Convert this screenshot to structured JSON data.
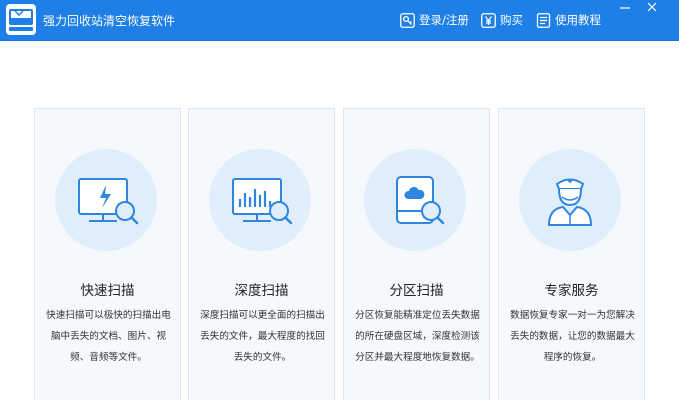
{
  "window": {
    "title": "强力回收站清空恢复软件"
  },
  "toolbar": {
    "login_label": "登录/注册",
    "buy_label": "购买",
    "tutorial_label": "使用教程"
  },
  "cards": [
    {
      "title": "快速扫描",
      "desc": "快速扫描可以极快的扫描出电脑中丢失的文档、图片、视频、音频等文件。",
      "icon": "monitor-lightning-search-icon"
    },
    {
      "title": "深度扫描",
      "desc": "深度扫描可以更全面的扫描出丢失的文件，最大程度的找回丢失的文件。",
      "icon": "monitor-chart-search-icon"
    },
    {
      "title": "分区扫描",
      "desc": "分区恢复能精准定位丢失数据的所在硬盘区域，深度检测该分区并最大程度地恢复数据。",
      "icon": "disk-cloud-search-icon"
    },
    {
      "title": "专家服务",
      "desc": "数据恢复专家一对一为您解决丢失的数据，让您的数据最大程序的恢复。",
      "icon": "doctor-icon"
    }
  ],
  "colors": {
    "titlebar": "#1e7fe6",
    "icon_stroke": "#2f86e0",
    "circle_bg": "#dfeefa",
    "card_bg": "#f5f8fc"
  }
}
